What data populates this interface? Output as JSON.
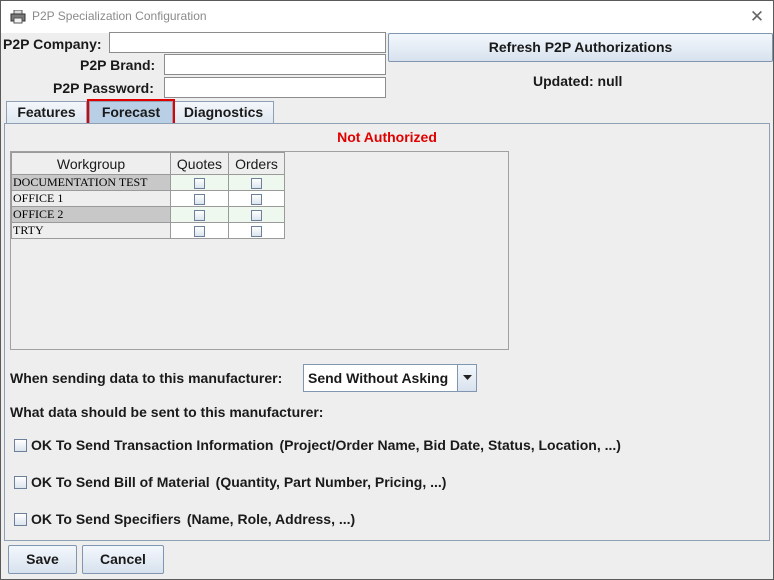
{
  "window": {
    "title": "P2P Specialization Configuration",
    "close_glyph": "✕"
  },
  "credentials": {
    "company_label": "P2P Company:",
    "company_value": "",
    "brand_label": "P2P Brand:",
    "brand_value": "",
    "password_label": "P2P Password:",
    "password_value": ""
  },
  "refresh_button": "Refresh P2P Authorizations",
  "updated_text": "Updated: null",
  "tabs": [
    {
      "label": "Features",
      "selected": false
    },
    {
      "label": "Forecast",
      "selected": true
    },
    {
      "label": "Diagnostics",
      "selected": false
    }
  ],
  "status": {
    "text": "Not Authorized",
    "color": "#e00000"
  },
  "workgroup_table": {
    "columns": [
      "Workgroup",
      "Quotes",
      "Orders"
    ],
    "rows": [
      {
        "name": "DOCUMENTATION TEST",
        "quotes": false,
        "orders": false
      },
      {
        "name": "OFFICE 1",
        "quotes": false,
        "orders": false
      },
      {
        "name": "OFFICE 2",
        "quotes": false,
        "orders": false
      },
      {
        "name": "TRTY",
        "quotes": false,
        "orders": false
      }
    ]
  },
  "sending": {
    "label": "When sending data to this manufacturer:",
    "selected": "Send Without Asking"
  },
  "what_data_label": "What data should be sent to this manufacturer:",
  "options": [
    {
      "label": "OK To Send Transaction Information",
      "detail": "(Project/Order Name, Bid Date, Status, Location, ...)",
      "checked": false
    },
    {
      "label": "OK To Send Bill of Material",
      "detail": "(Quantity, Part Number, Pricing, ...)",
      "checked": false
    },
    {
      "label": "OK To Send Specifiers",
      "detail": "(Name, Role, Address, ...)",
      "checked": false
    }
  ],
  "footer": {
    "save_label": "Save",
    "cancel_label": "Cancel"
  },
  "icons": {
    "app": "printer-icon",
    "dropdown": "chevron-down-icon"
  },
  "colors": {
    "tab_selected": "#b8cfe5",
    "highlight": "#e00000"
  }
}
